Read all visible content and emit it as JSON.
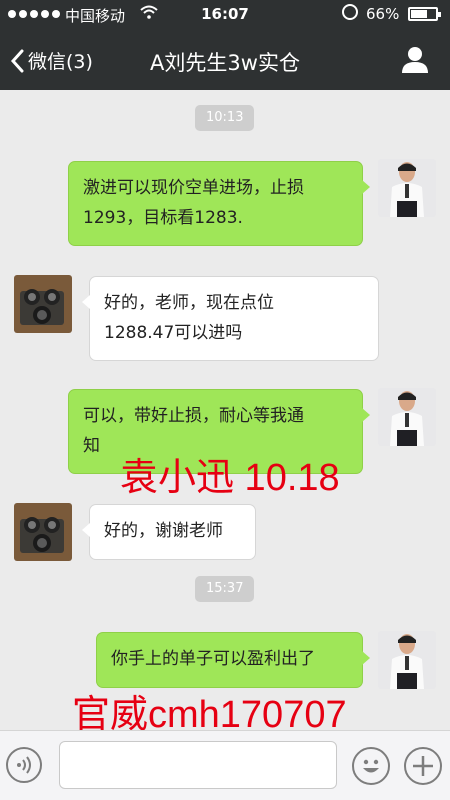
{
  "status_bar": {
    "carrier": "中国移动",
    "time": "16:07",
    "battery_percent": "66%",
    "battery_level": 0.66,
    "wifi_icon": "wifi-icon",
    "lock_icon": "rotation-lock-icon"
  },
  "nav": {
    "back_label": "微信(3)",
    "title": "A刘先生3w实仓",
    "contact_icon": "person-icon"
  },
  "messages": [
    {
      "type": "timestamp",
      "text": "10:13"
    },
    {
      "type": "outgoing",
      "lines": [
        "激进可以现价空单进场，止损",
        "1293，目标看1283."
      ]
    },
    {
      "type": "incoming",
      "lines": [
        "好的，老师，现在点位",
        "1288.47可以进吗"
      ]
    },
    {
      "type": "outgoing",
      "lines": [
        "可以，带好止损，耐心等我通",
        "知"
      ]
    },
    {
      "type": "incoming",
      "lines": [
        "好的，谢谢老师"
      ]
    },
    {
      "type": "timestamp",
      "text": "15:37"
    },
    {
      "type": "outgoing",
      "lines": [
        "你手上的单子可以盈利出了"
      ]
    }
  ],
  "watermarks": {
    "line1": "袁小迅  10.18",
    "line2": "官威cmh170707"
  },
  "input_bar": {
    "placeholder": "",
    "voice_icon": "voice-icon",
    "emoji_icon": "emoji-icon",
    "plus_icon": "plus-icon"
  },
  "colors": {
    "header": "#2e3132",
    "outgoing_bubble": "#9fe658",
    "incoming_bubble": "#ffffff",
    "chat_bg": "#ebebeb",
    "watermark": "#e60012"
  }
}
